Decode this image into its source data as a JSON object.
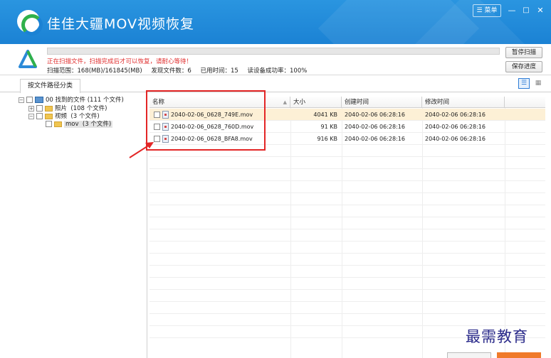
{
  "app": {
    "title": "佳佳大疆MOV视频恢复"
  },
  "window_controls": {
    "menu": "菜单",
    "minimize": "—",
    "maximize": "□",
    "close": "✕"
  },
  "scan": {
    "progress_fraction": 0.0,
    "message": "正在扫描文件，扫描完成后才可以恢复，请耐心等待！",
    "stats": {
      "range": "扫描范围：168(MB)/161845(MB)",
      "found": "发现文件数：6",
      "elapsed": "已用时间：15",
      "success_rate": "读设备成功率：100%"
    },
    "buttons": {
      "pause": "暂停扫描",
      "save_progress": "保存进度"
    }
  },
  "tabs": [
    {
      "label": "按文件路径分类"
    }
  ],
  "tree": {
    "root": "00 找到的文件 (111 个文件)",
    "items": [
      {
        "label": "照片",
        "count": "(108 个文件)"
      },
      {
        "label": "视频",
        "count": "(3 个文件)"
      }
    ],
    "subitem": {
      "label": "mov",
      "count": "(3 个文件)"
    }
  },
  "table": {
    "columns": {
      "name": "名称",
      "size": "大小",
      "created": "创建时间",
      "modified": "修改时间"
    },
    "rows": [
      {
        "name": "2040-02-06_0628_749E.mov",
        "size": "4041 KB",
        "created": "2040-02-06  06:28:16",
        "modified": "2040-02-06  06:28:16"
      },
      {
        "name": "2040-02-06_0628_760D.mov",
        "size": "91 KB",
        "created": "2040-02-06  06:28:16",
        "modified": "2040-02-06  06:28:16"
      },
      {
        "name": "2040-02-06_0628_BFA8.mov",
        "size": "916 KB",
        "created": "2040-02-06  06:28:16",
        "modified": "2040-02-06  06:28:16"
      }
    ]
  },
  "watermark": "最需教育",
  "colors": {
    "titlebar": "#1b82d4",
    "accent": "#2fb14b",
    "annotation": "#e32626",
    "highlight_row": "#fdf0d6"
  }
}
